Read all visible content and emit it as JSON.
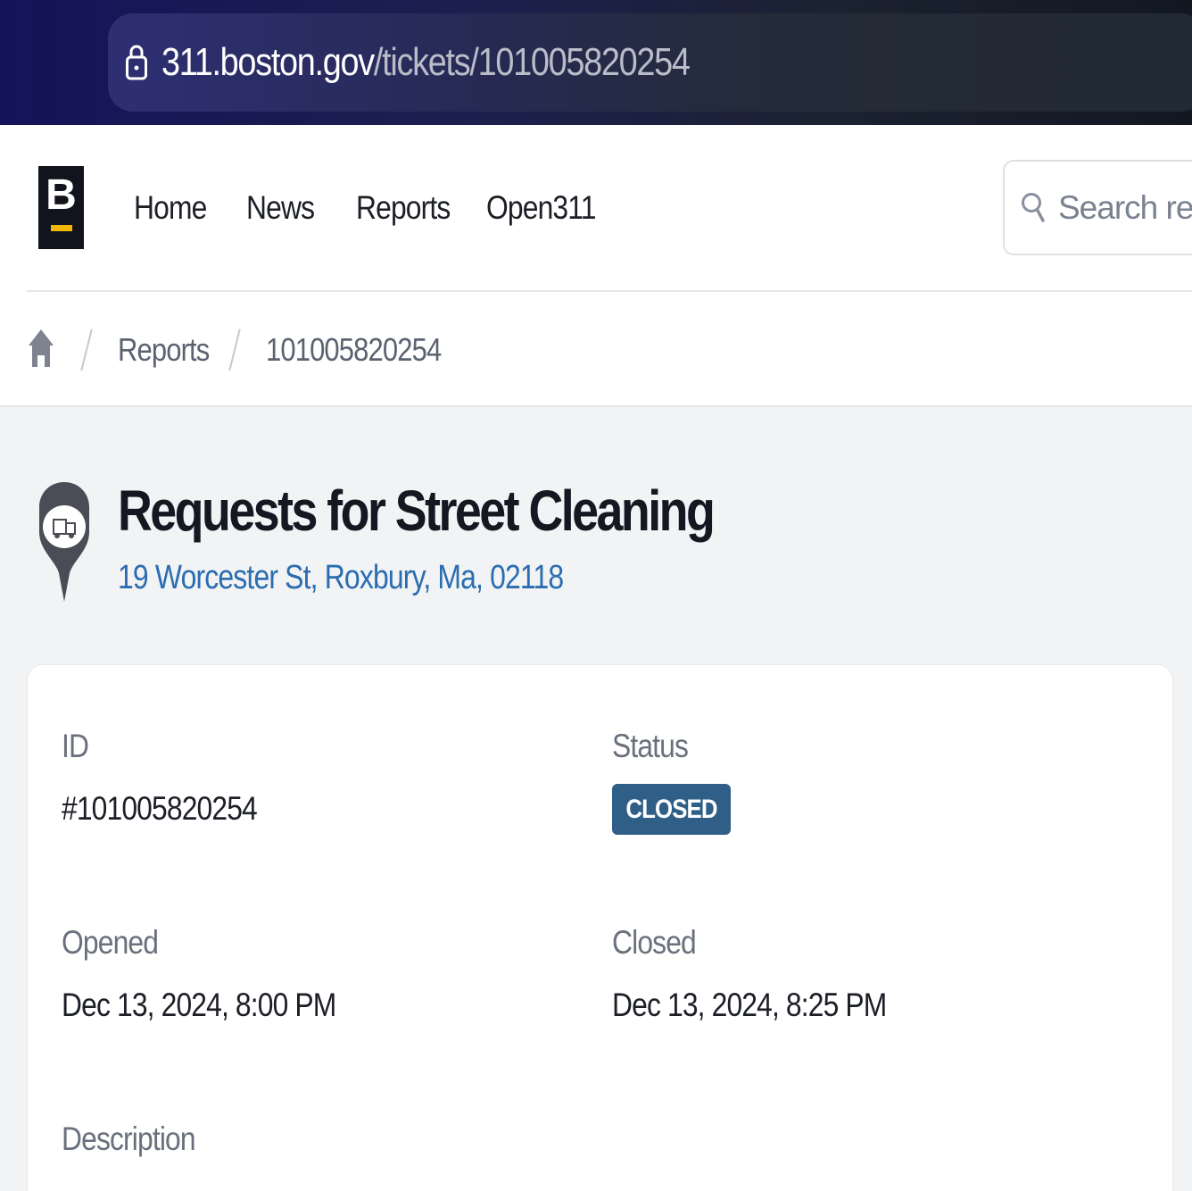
{
  "browser": {
    "url_host": "311.boston.gov",
    "url_path": "/tickets/101005820254",
    "icon": "lock-icon"
  },
  "header": {
    "logo_letter": "B",
    "nav": [
      {
        "label": "Home"
      },
      {
        "label": "News"
      },
      {
        "label": "Reports"
      },
      {
        "label": "Open311"
      }
    ],
    "search_placeholder": "Search reports"
  },
  "breadcrumb": {
    "home_icon": "home-icon",
    "items": [
      "Reports",
      "101005820254"
    ]
  },
  "ticket": {
    "title": "Requests for Street Cleaning",
    "address": "19 Worcester St, Roxbury, Ma, 02118",
    "category_icon": "street-sweeper-truck-icon",
    "fields": {
      "id_label": "ID",
      "id_value": "#101005820254",
      "status_label": "Status",
      "status_value": "CLOSED",
      "opened_label": "Opened",
      "opened_value": "Dec 13, 2024, 8:00 PM",
      "closed_label": "Closed",
      "closed_value": "Dec 13, 2024, 8:25 PM",
      "description_label": "Description"
    }
  },
  "colors": {
    "status_badge": "#2f5e86",
    "link": "#2a6db0",
    "logo_accent": "#f2b705"
  }
}
